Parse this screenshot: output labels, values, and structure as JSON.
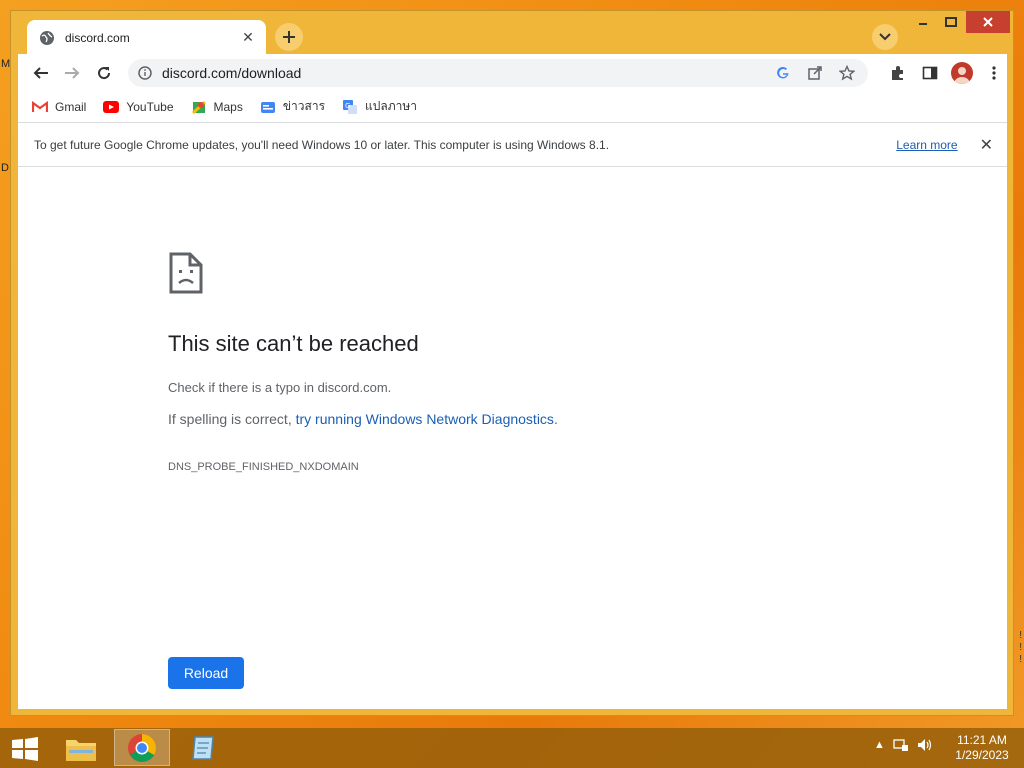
{
  "desktop": {
    "left_letters": [
      "M",
      "D"
    ],
    "right_marks": [
      "!",
      "!",
      "!"
    ]
  },
  "tab": {
    "title": "discord.com",
    "close": "✕"
  },
  "toolbar": {
    "url": "discord.com/download"
  },
  "bookmarks": [
    {
      "label": "Gmail",
      "icon": "gmail-icon"
    },
    {
      "label": "YouTube",
      "icon": "youtube-icon"
    },
    {
      "label": "Maps",
      "icon": "maps-icon"
    },
    {
      "label": "ข่าวสาร",
      "icon": "news-icon"
    },
    {
      "label": "แปลภาษา",
      "icon": "translate-icon"
    }
  ],
  "infobar": {
    "message": "To get future Google Chrome updates, you'll need Windows 10 or later. This computer is using Windows 8.1.",
    "link": "Learn more",
    "close": "✕"
  },
  "error": {
    "title": "This site can’t be reached",
    "line1": "Check if there is a typo in discord.com.",
    "line2_prefix": "If spelling is correct, ",
    "line2_link": "try running Windows Network Diagnostics",
    "line2_suffix": ".",
    "code": "DNS_PROBE_FINISHED_NXDOMAIN",
    "reload": "Reload"
  },
  "taskbar": {
    "time": "11:21 AM",
    "date": "1/29/2023"
  },
  "colors": {
    "accent": "#1a73e8",
    "window_frame": "#f0b63a",
    "close_button": "#c7402f"
  }
}
